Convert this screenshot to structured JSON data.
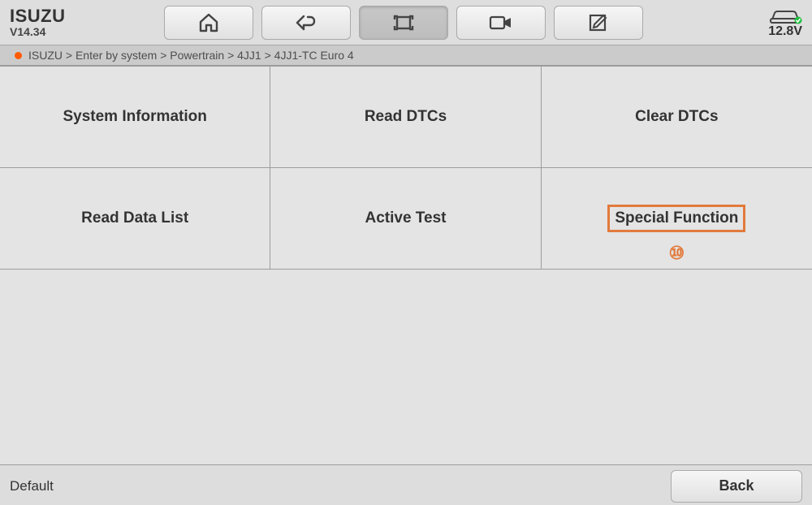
{
  "header": {
    "brand": "ISUZU",
    "version": "V14.34",
    "voltage": "12.8V"
  },
  "breadcrumb": "ISUZU > Enter by system > Powertrain > 4JJ1 > 4JJ1-TC Euro 4",
  "menu": {
    "items": [
      "System Information",
      "Read DTCs",
      "Clear DTCs",
      "Read Data List",
      "Active Test",
      "Special Function"
    ]
  },
  "annotation": {
    "highlight_index": 5,
    "marker": "⑩"
  },
  "footer": {
    "left": "Default",
    "back": "Back"
  }
}
